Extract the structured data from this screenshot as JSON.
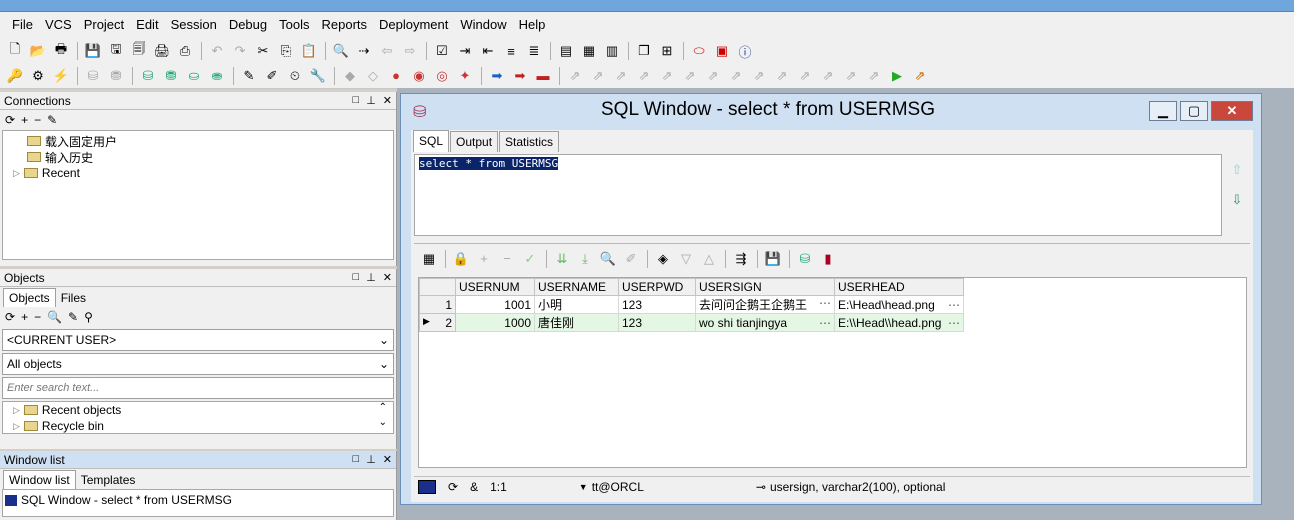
{
  "menu": [
    "File",
    "VCS",
    "Project",
    "Edit",
    "Session",
    "Debug",
    "Tools",
    "Reports",
    "Deployment",
    "Window",
    "Help"
  ],
  "menu_underline": [
    "F",
    "",
    "P",
    "E",
    "S",
    "D",
    "T",
    "R",
    "",
    "W",
    "H"
  ],
  "connections": {
    "title": "Connections",
    "items": [
      "载入固定用户",
      "输入历史",
      "Recent"
    ]
  },
  "objects": {
    "title": "Objects",
    "tabs": [
      "Objects",
      "Files"
    ],
    "user_select": "<CURRENT USER>",
    "filter_select": "All objects",
    "search_placeholder": "Enter search text...",
    "items": [
      "Recent objects",
      "Recycle bin"
    ]
  },
  "window_list": {
    "title": "Window list",
    "tabs": [
      "Window list",
      "Templates"
    ],
    "items": [
      "SQL Window - select * from USERMSG"
    ]
  },
  "sql_window": {
    "title": "SQL Window - select * from USERMSG",
    "tabs": [
      "SQL",
      "Output",
      "Statistics"
    ],
    "query": "select * from USERMSG"
  },
  "grid": {
    "columns": [
      "USERNUM",
      "USERNAME",
      "USERPWD",
      "USERSIGN",
      "USERHEAD"
    ],
    "rows": [
      {
        "n": "1",
        "usernum": "1001",
        "username": "小明",
        "userpwd": "123",
        "usersign": "去问问企鹅王企鹅王",
        "userhead": "E:\\Head\\head.png"
      },
      {
        "n": "2",
        "usernum": "1000",
        "username": "唐佳刚",
        "userpwd": "123",
        "usersign": "wo shi tianjingya",
        "userhead": "E:\\\\Head\\\\head.png"
      }
    ]
  },
  "status": {
    "position": "1:1",
    "amp": "&",
    "connection": "tt@ORCL",
    "column_info": "usersign, varchar2(100), optional"
  },
  "colors": {
    "accent": "#0a246a",
    "current_row": "#e4f6e4",
    "close_button": "#c9483b"
  }
}
